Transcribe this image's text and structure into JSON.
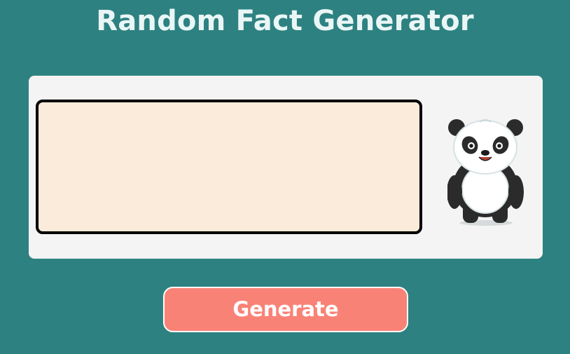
{
  "app": {
    "title": "Random Fact Generator"
  },
  "fact": {
    "text": ""
  },
  "panda": {
    "icon": "panda-icon"
  },
  "actions": {
    "generate_label": "Generate"
  },
  "colors": {
    "background": "#2e8181",
    "card": "#f4f4f4",
    "fact_box": "#faebda",
    "button": "#f98276",
    "title": "#eaf6f6"
  }
}
